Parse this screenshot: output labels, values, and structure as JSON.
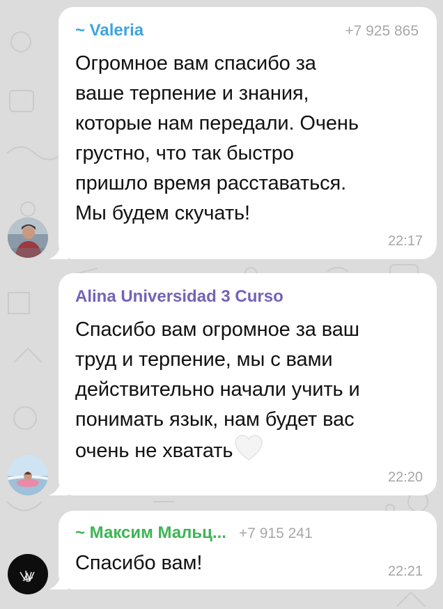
{
  "messages": [
    {
      "sender": "~ Valeria",
      "sender_color": "#3fa3e0",
      "phone": "+7 925 865",
      "text": "Огромное вам спасибо за\nваше терпение и знания,\nкоторые нам передали. Очень\nгрустно, что так быстро\nпришло время расставаться.\nМы будем скучать!",
      "time": "22:17",
      "avatar_icon": "user-photo"
    },
    {
      "sender": "Alina Universidad 3 Curso",
      "sender_color": "#7462b8",
      "text": "Спасибо вам огромное за ваш\nтруд и терпение, мы с вами\nдействительно начали учить и\nпонимать язык, нам будет вас\nочень не хватать",
      "emoji": "white-heart-icon",
      "time": "22:20",
      "avatar_icon": "user-photo"
    },
    {
      "sender": "~ Максим Мальц...",
      "sender_color": "#3cb554",
      "phone": "+7 915 241",
      "text": "Спасибо вам!",
      "time": "22:21",
      "avatar_icon": "user-photo"
    }
  ],
  "colors": {
    "background": "#dcdcdc",
    "bubble": "#ffffff",
    "meta_text": "#a5a5a5"
  }
}
